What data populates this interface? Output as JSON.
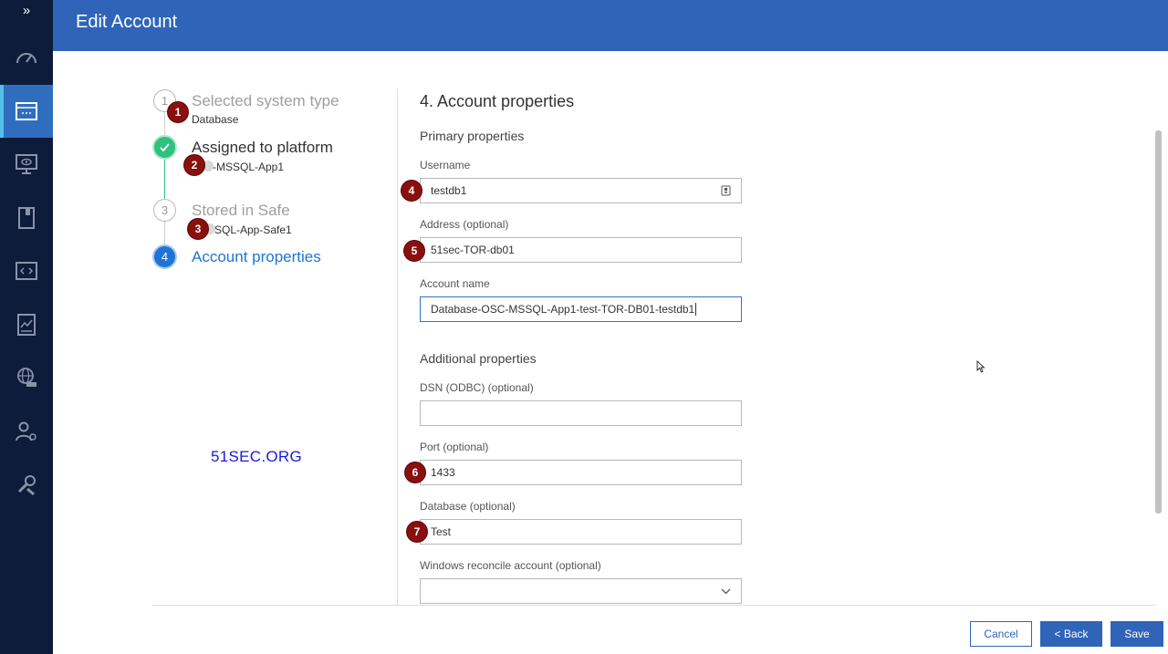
{
  "header": {
    "title": "Edit Account"
  },
  "sidebar": {
    "expand_glyph": "»",
    "items": [
      {
        "icon": "dashboard-icon"
      },
      {
        "icon": "accounts-icon",
        "active": true
      },
      {
        "icon": "monitoring-icon"
      },
      {
        "icon": "policies-icon"
      },
      {
        "icon": "applications-icon"
      },
      {
        "icon": "reports-icon"
      },
      {
        "icon": "network-icon"
      },
      {
        "icon": "users-settings-icon"
      },
      {
        "icon": "administration-icon"
      }
    ]
  },
  "stepper": {
    "steps": [
      {
        "number": "1",
        "label": "Selected system type",
        "sub": "Database",
        "state": "pending"
      },
      {
        "number": "2",
        "label": "Assigned to platform",
        "sub": "-MSSQL-App1",
        "state": "done"
      },
      {
        "number": "3",
        "label": "Stored in Safe",
        "sub": "-SQL-App-Safe1",
        "state": "pending"
      },
      {
        "number": "4",
        "label": "Account properties",
        "sub": "",
        "state": "current"
      }
    ]
  },
  "watermark": "51SEC.ORG",
  "form": {
    "title": "4. Account properties",
    "primary_title": "Primary properties",
    "additional_title": "Additional properties",
    "fields": {
      "username": {
        "label": "Username",
        "value": "testdb1"
      },
      "address": {
        "label": "Address (optional)",
        "value": "51sec-TOR-db01"
      },
      "account_name": {
        "label": "Account name",
        "value": "Database-OSC-MSSQL-App1-test-TOR-DB01-testdb1"
      },
      "dsn": {
        "label": "DSN (ODBC) (optional)",
        "value": ""
      },
      "port": {
        "label": "Port (optional)",
        "value": "1433"
      },
      "database": {
        "label": "Database (optional)",
        "value": "Test"
      },
      "reconcile": {
        "label": "Windows reconcile account (optional)",
        "value": ""
      }
    }
  },
  "annotations": [
    "1",
    "2",
    "3",
    "4",
    "5",
    "6",
    "7"
  ],
  "buttons": {
    "cancel": "Cancel",
    "back": "< Back",
    "save": "Save"
  },
  "colors": {
    "header": "#2f64b8",
    "sidebar": "#0d1c3b",
    "badge": "#8a1010",
    "step_done": "#2ec27e",
    "step_current": "#1d74d6"
  }
}
